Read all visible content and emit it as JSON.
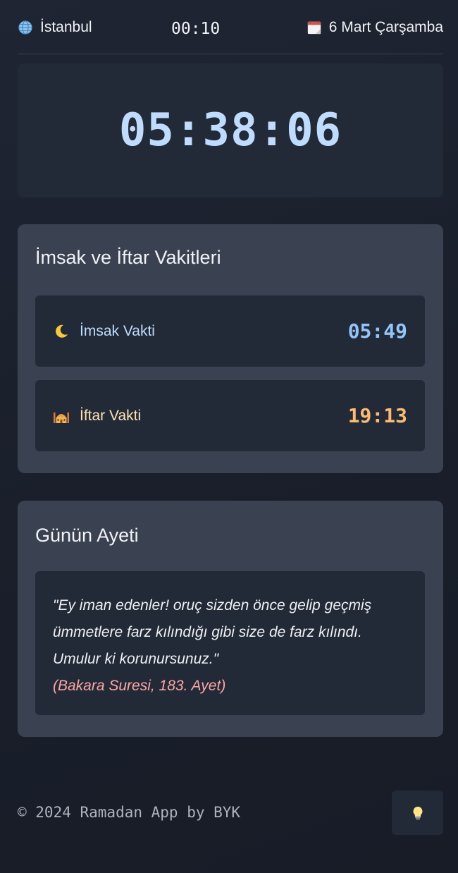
{
  "header": {
    "city": "İstanbul",
    "clock": "00:10",
    "date": "6 Mart Çarşamba",
    "city_icon": "globe-icon",
    "date_icon": "calendar-icon"
  },
  "countdown": {
    "value": "05:38:06"
  },
  "times": {
    "title": "İmsak ve İftar Vakitleri",
    "imsak": {
      "label": "İmsak Vakti",
      "time": "05:49",
      "icon": "crescent-moon-icon"
    },
    "iftar": {
      "label": "İftar Vakti",
      "time": "19:13",
      "icon": "mosque-icon"
    }
  },
  "verse": {
    "title": "Günün Ayeti",
    "text": "\"Ey iman edenler! oruç sizden önce gelip geçmiş ümmetlere farz kılındığı gibi size de farz kılındı. Umulur ki korunursunuz.\"",
    "reference": "(Bakara Suresi, 183. Ayet)"
  },
  "footer": {
    "copyright": "© 2024 Ramadan App by BYK",
    "theme_button_icon": "lightbulb-icon"
  },
  "colors": {
    "accent_blue": "#93c5fd",
    "accent_orange": "#fdba74",
    "reference_pink": "#fca5a5",
    "card_bg": "#3a4150",
    "inner_bg": "#232a37"
  }
}
